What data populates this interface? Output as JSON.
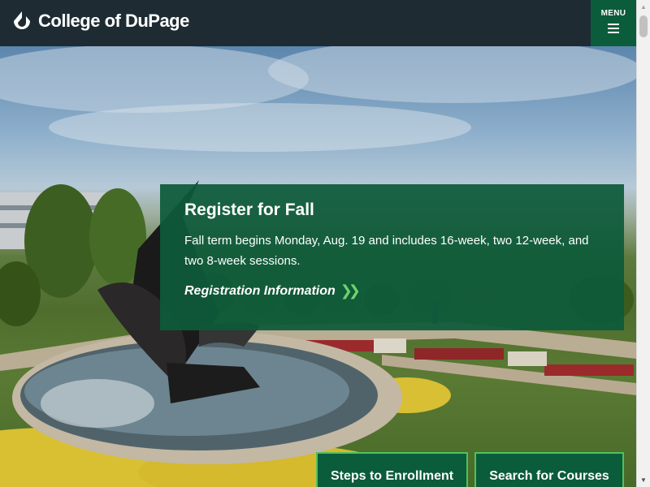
{
  "header": {
    "logo_text": "College of DuPage",
    "menu_label": "MENU"
  },
  "promo": {
    "title": "Register for Fall",
    "body": "Fall term begins Monday, Aug. 19 and includes 16-week, two 12-week, and two 8-week sessions.",
    "link_label": "Registration Information"
  },
  "cta": {
    "enroll_label": "Steps to Enrollment",
    "search_label": "Search for Courses"
  },
  "colors": {
    "header_bg": "#1e2b33",
    "brand_green": "#0a5c3a",
    "accent_green": "#52c05b"
  },
  "icons": {
    "logo": "cod-logo-icon",
    "menu": "hamburger-icon",
    "link_arrow": "double-chevron-right-icon"
  }
}
